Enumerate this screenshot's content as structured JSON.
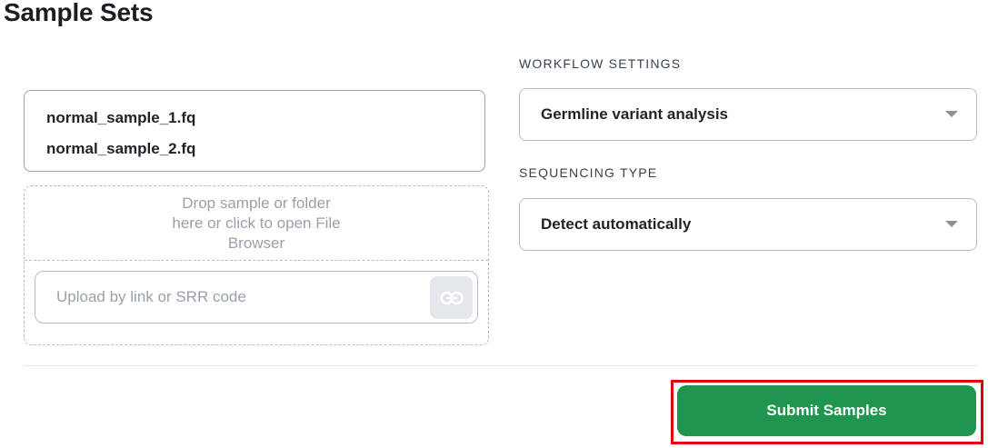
{
  "page": {
    "title": "Sample Sets"
  },
  "samples": {
    "files": [
      "normal_sample_1.fq",
      "normal_sample_2.fq"
    ]
  },
  "dropzone": {
    "lines": [
      "Drop sample or folder",
      "here or click to open File",
      "Browser"
    ],
    "link_placeholder": "Upload by link or SRR code",
    "link_value": "",
    "link_icon": "link-icon"
  },
  "workflow": {
    "label": "WORKFLOW SETTINGS",
    "selected": "Germline variant analysis"
  },
  "sequencing": {
    "label": "SEQUENCING TYPE",
    "selected": "Detect automatically"
  },
  "actions": {
    "submit_label": "Submit Samples"
  },
  "colors": {
    "submit": "#209550",
    "highlight": "#e3000f"
  }
}
